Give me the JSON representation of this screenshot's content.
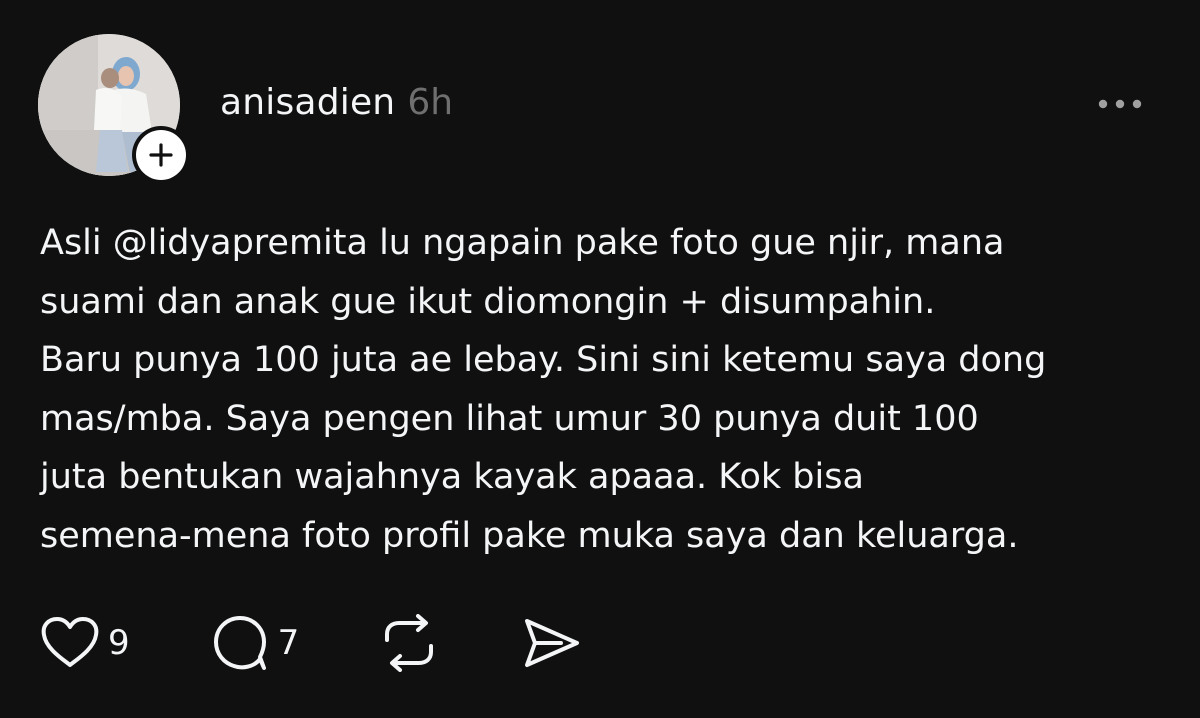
{
  "post": {
    "author": {
      "username": "anisadien",
      "avatar": "profile-photo",
      "follow_icon": "plus-icon"
    },
    "timestamp": "6h",
    "more_icon": "ellipsis-icon",
    "content_lines": [
      "Asli @lidyapremita lu ngapain pake foto gue njir, mana",
      "suami dan anak gue ikut diomongin + disumpahin.",
      "Baru punya 100 juta ae lebay. Sini sini ketemu saya dong",
      "mas/mba. Saya pengen lihat umur 30 punya duit 100",
      "juta bentukan wajahnya kayak apaaa. Kok bisa",
      "semena-mena foto profil pake muka saya dan keluarga."
    ],
    "actions": {
      "like": {
        "icon": "heart-icon",
        "count": "9"
      },
      "reply": {
        "icon": "comment-icon",
        "count": "7"
      },
      "repost": {
        "icon": "repost-icon"
      },
      "share": {
        "icon": "send-icon"
      }
    }
  },
  "colors": {
    "background": "#101010",
    "text_primary": "#f3f5f7",
    "text_secondary": "#6f6f6f",
    "badge_background": "#ffffff"
  }
}
